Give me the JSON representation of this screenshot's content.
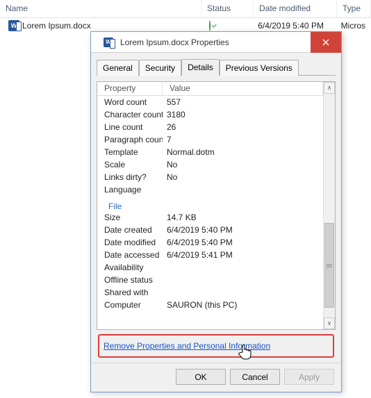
{
  "explorer": {
    "columns": {
      "name": "Name",
      "status": "Status",
      "date": "Date modified",
      "type": "Type"
    },
    "row": {
      "filename": "Lorem Ipsum.docx",
      "date": "6/4/2019 5:40 PM",
      "type": "Micros"
    }
  },
  "dialog": {
    "title": "Lorem Ipsum.docx Properties",
    "tabs": {
      "general": "General",
      "security": "Security",
      "details": "Details",
      "previous": "Previous Versions"
    },
    "grid_headers": {
      "property": "Property",
      "value": "Value"
    },
    "rows_top": [
      {
        "p": "Word count",
        "v": "557"
      },
      {
        "p": "Character count",
        "v": "3180"
      },
      {
        "p": "Line count",
        "v": "26"
      },
      {
        "p": "Paragraph count",
        "v": "7"
      },
      {
        "p": "Template",
        "v": "Normal.dotm"
      },
      {
        "p": "Scale",
        "v": "No"
      },
      {
        "p": "Links dirty?",
        "v": "No"
      },
      {
        "p": "Language",
        "v": ""
      }
    ],
    "section": "File",
    "rows_bottom": [
      {
        "p": "Size",
        "v": "14.7 KB"
      },
      {
        "p": "Date created",
        "v": "6/4/2019 5:40 PM"
      },
      {
        "p": "Date modified",
        "v": "6/4/2019 5:40 PM"
      },
      {
        "p": "Date accessed",
        "v": "6/4/2019 5:41 PM"
      },
      {
        "p": "Availability",
        "v": ""
      },
      {
        "p": "Offline status",
        "v": ""
      },
      {
        "p": "Shared with",
        "v": ""
      },
      {
        "p": "Computer",
        "v": "SAURON (this PC)"
      }
    ],
    "link": "Remove Properties and Personal Information",
    "buttons": {
      "ok": "OK",
      "cancel": "Cancel",
      "apply": "Apply"
    }
  }
}
